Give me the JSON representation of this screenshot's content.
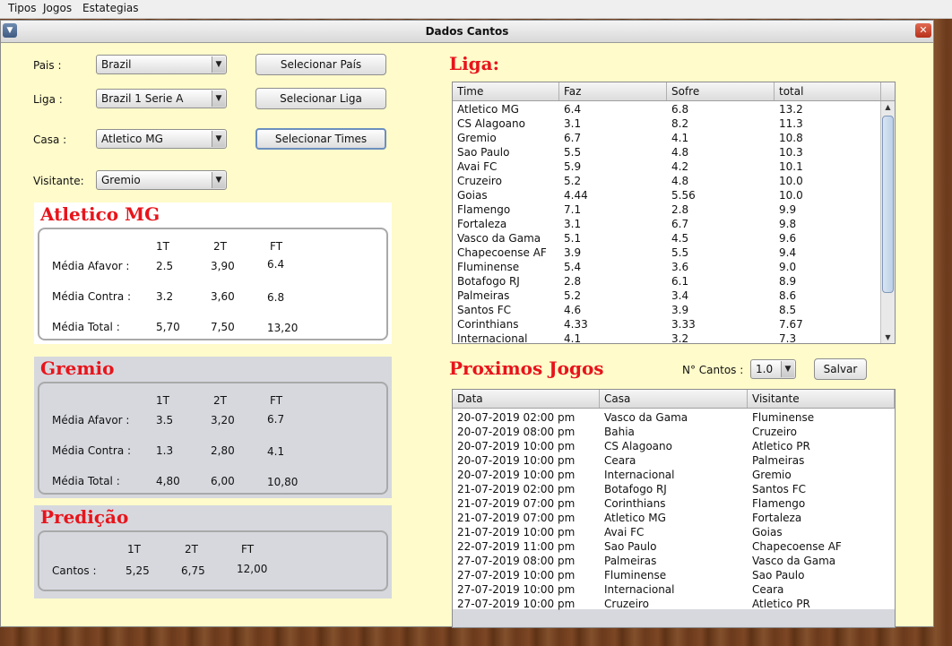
{
  "menu": [
    "Tipos",
    "Jogos",
    "Estategias"
  ],
  "window": {
    "title": "Dados Cantos"
  },
  "form": {
    "pais_label": "Pais :",
    "pais_value": "Brazil",
    "pais_button": "Selecionar País",
    "liga_label": "Liga :",
    "liga_value": "Brazil 1 Serie A",
    "liga_button": "Selecionar Liga",
    "casa_label": "Casa :",
    "casa_value": "Atletico MG",
    "casa_button": "Selecionar Times",
    "visitante_label": "Visitante:",
    "visitante_value": "Gremio"
  },
  "home": {
    "name": "Atletico MG",
    "col_1t": "1T",
    "col_2t": "2T",
    "col_ft": "FT",
    "afavor_label": "Média Afavor :",
    "afavor": [
      "2.5",
      "3,90",
      "6.4"
    ],
    "contra_label": "Média Contra :",
    "contra": [
      "3.2",
      "3,60",
      "6.8"
    ],
    "total_label": "Média Total :",
    "total": [
      "5,70",
      "7,50",
      "13,20"
    ]
  },
  "away": {
    "name": "Gremio",
    "col_1t": "1T",
    "col_2t": "2T",
    "col_ft": "FT",
    "afavor_label": "Média Afavor :",
    "afavor": [
      "3.5",
      "3,20",
      "6.7"
    ],
    "contra_label": "Média Contra :",
    "contra": [
      "1.3",
      "2,80",
      "4.1"
    ],
    "total_label": "Média Total :",
    "total": [
      "4,80",
      "6,00",
      "10,80"
    ]
  },
  "prediction": {
    "title": "Predição",
    "col_1t": "1T",
    "col_2t": "2T",
    "col_ft": "FT",
    "label": "Cantos :",
    "values": [
      "5,25",
      "6,75",
      "12,00"
    ]
  },
  "liga": {
    "title": "Liga:",
    "columns": [
      "Time",
      "Faz",
      "Sofre",
      "total"
    ],
    "rows": [
      [
        "Atletico MG",
        "6.4",
        "6.8",
        "13.2"
      ],
      [
        "CS Alagoano",
        "3.1",
        "8.2",
        "11.3"
      ],
      [
        "Gremio",
        "6.7",
        "4.1",
        "10.8"
      ],
      [
        "Sao Paulo",
        "5.5",
        "4.8",
        "10.3"
      ],
      [
        "Avai FC",
        "5.9",
        "4.2",
        "10.1"
      ],
      [
        "Cruzeiro",
        "5.2",
        "4.8",
        "10.0"
      ],
      [
        "Goias",
        "4.44",
        "5.56",
        "10.0"
      ],
      [
        "Flamengo",
        "7.1",
        "2.8",
        "9.9"
      ],
      [
        "Fortaleza",
        "3.1",
        "6.7",
        "9.8"
      ],
      [
        "Vasco da Gama",
        "5.1",
        "4.5",
        "9.6"
      ],
      [
        "Chapecoense AF",
        "3.9",
        "5.5",
        "9.4"
      ],
      [
        "Fluminense",
        "5.4",
        "3.6",
        "9.0"
      ],
      [
        "Botafogo RJ",
        "2.8",
        "6.1",
        "8.9"
      ],
      [
        "Palmeiras",
        "5.2",
        "3.4",
        "8.6"
      ],
      [
        "Santos FC",
        "4.6",
        "3.9",
        "8.5"
      ],
      [
        "Corinthians",
        "4.33",
        "3.33",
        "7.67"
      ],
      [
        "Internacional",
        "4.1",
        "3.2",
        "7.3"
      ]
    ]
  },
  "jogos": {
    "title": "Proximos Jogos",
    "cantos_label": "N° Cantos :",
    "cantos_value": "1.0",
    "save_label": "Salvar",
    "columns": [
      "Data",
      "Casa",
      "Visitante"
    ],
    "rows": [
      [
        "20-07-2019 02:00 pm",
        "Vasco da Gama",
        "Fluminense"
      ],
      [
        "20-07-2019 08:00 pm",
        "Bahia",
        "Cruzeiro"
      ],
      [
        "20-07-2019 10:00 pm",
        "CS Alagoano",
        "Atletico PR"
      ],
      [
        "20-07-2019 10:00 pm",
        "Ceara",
        "Palmeiras"
      ],
      [
        "20-07-2019 10:00 pm",
        "Internacional",
        "Gremio"
      ],
      [
        "21-07-2019 02:00 pm",
        "Botafogo RJ",
        "Santos FC"
      ],
      [
        "21-07-2019 07:00 pm",
        "Corinthians",
        "Flamengo"
      ],
      [
        "21-07-2019 07:00 pm",
        "Atletico MG",
        "Fortaleza"
      ],
      [
        "21-07-2019 10:00 pm",
        "Avai FC",
        "Goias"
      ],
      [
        "22-07-2019 11:00 pm",
        "Sao Paulo",
        "Chapecoense AF"
      ],
      [
        "27-07-2019 08:00 pm",
        "Palmeiras",
        "Vasco da Gama"
      ],
      [
        "27-07-2019 10:00 pm",
        "Fluminense",
        "Sao Paulo"
      ],
      [
        "27-07-2019 10:00 pm",
        "Internacional",
        "Ceara"
      ],
      [
        "27-07-2019 10:00 pm",
        "Cruzeiro",
        "Atletico PR"
      ]
    ]
  },
  "colors": {
    "accent_title": "#e8141b",
    "window_bg": "#fffbca",
    "panel_gray": "#d6d8de"
  },
  "icons": {
    "window_menu": "chevron-down-icon",
    "close": "close-icon",
    "combo_arrow": "caret-down-icon"
  }
}
